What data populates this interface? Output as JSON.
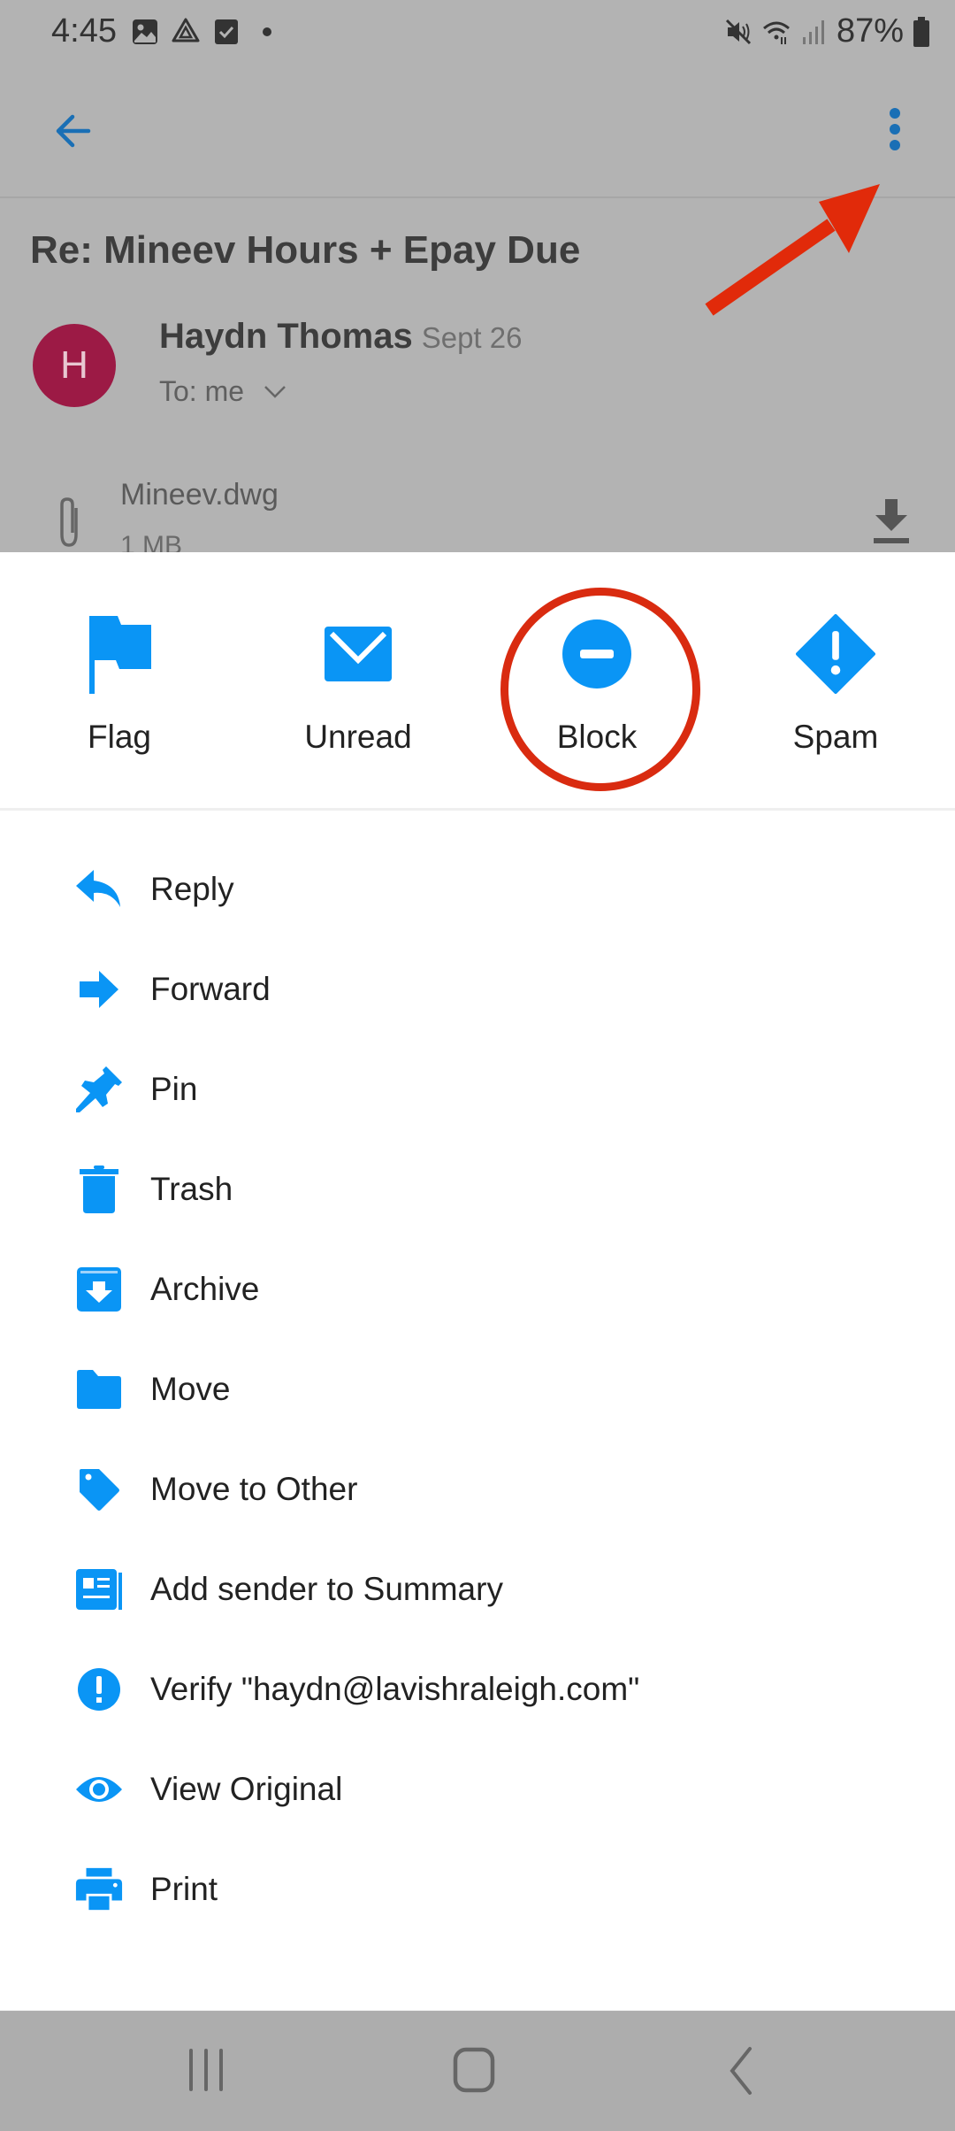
{
  "status_bar": {
    "time": "4:45",
    "left_icons": [
      "gallery-icon",
      "drive-icon",
      "tasks-icon",
      "dot-icon"
    ],
    "right_icons": [
      "mute-icon",
      "wifi-icon",
      "signal-icon"
    ],
    "battery": "87%"
  },
  "colors": {
    "accent": "#0a95f5",
    "annotation": "#d92b10",
    "avatar": "#9c1a45",
    "scrim": "#b3b3b3"
  },
  "email": {
    "subject": "Re: Mineev Hours + Epay Due",
    "avatar_initial": "H",
    "sender": "Haydn Thomas",
    "date": "Sept 26",
    "to": "To: me",
    "attachment": {
      "name": "Mineev.dwg",
      "size": "1 MB"
    }
  },
  "quick_actions": [
    {
      "label": "Flag",
      "icon": "flag-icon"
    },
    {
      "label": "Unread",
      "icon": "envelope-icon"
    },
    {
      "label": "Block",
      "icon": "block-icon"
    },
    {
      "label": "Spam",
      "icon": "spam-icon"
    }
  ],
  "menu": [
    {
      "label": "Reply",
      "icon": "reply-icon"
    },
    {
      "label": "Forward",
      "icon": "forward-icon"
    },
    {
      "label": "Pin",
      "icon": "pin-icon"
    },
    {
      "label": "Trash",
      "icon": "trash-icon"
    },
    {
      "label": "Archive",
      "icon": "archive-icon"
    },
    {
      "label": "Move",
      "icon": "folder-icon"
    },
    {
      "label": "Move to Other",
      "icon": "tag-icon"
    },
    {
      "label": "Add sender to Summary",
      "icon": "newspaper-icon"
    },
    {
      "label": "Verify \"haydn@lavishraleigh.com\"",
      "icon": "alert-circle-icon"
    },
    {
      "label": "View Original",
      "icon": "eye-icon"
    },
    {
      "label": "Print",
      "icon": "printer-icon"
    }
  ],
  "nav_bar": {
    "buttons": [
      "recents",
      "home",
      "back"
    ]
  }
}
